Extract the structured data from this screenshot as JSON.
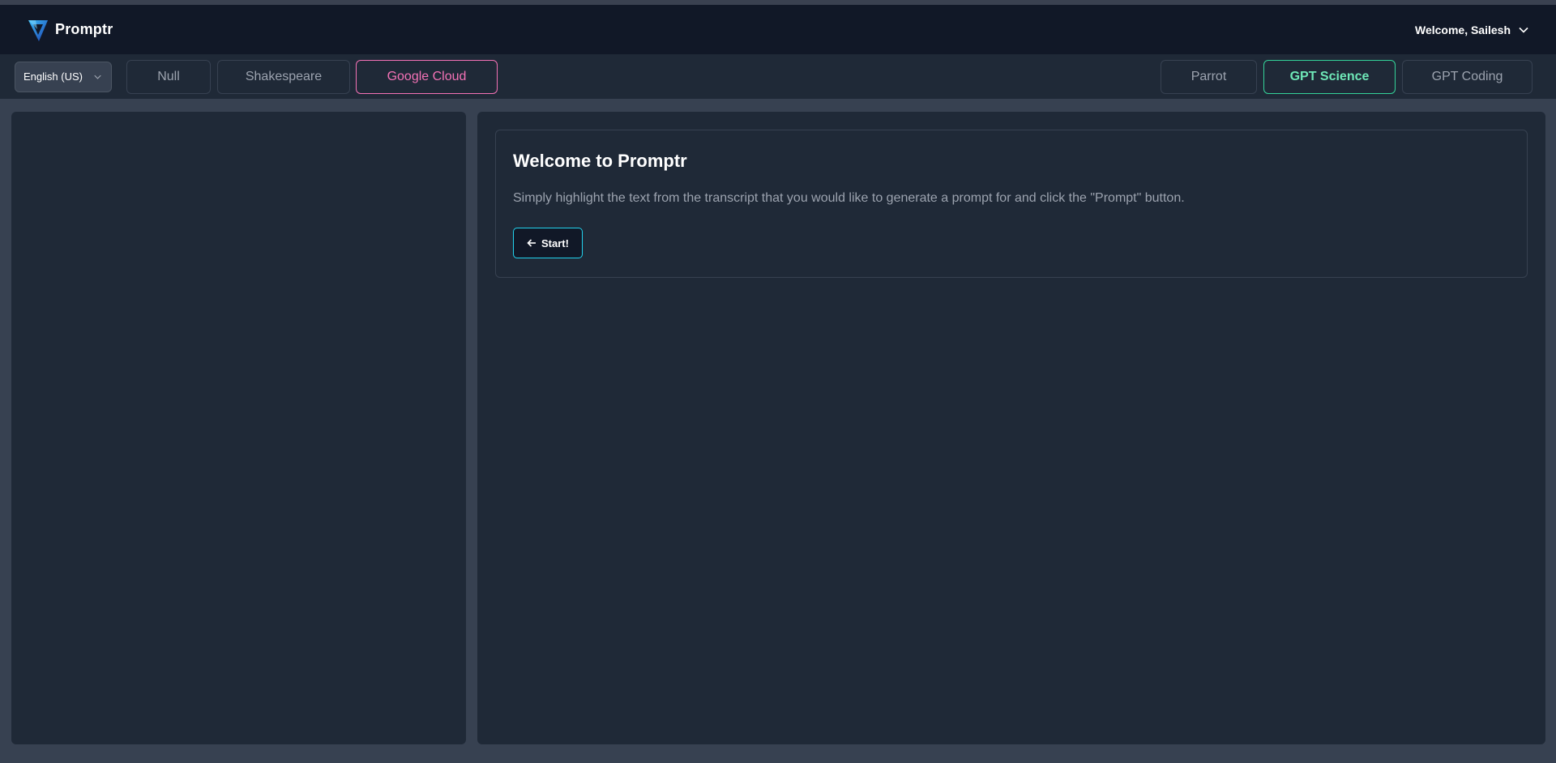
{
  "app": {
    "name": "Promptr",
    "logo_icon": "promptr-logo-icon"
  },
  "header": {
    "welcome_label": "Welcome, Sailesh",
    "menu_icon": "chevron-down-icon"
  },
  "toolbar": {
    "language": {
      "selected": "English (US)",
      "icon": "chevron-down-icon"
    },
    "left_modes": [
      {
        "label": "Null",
        "state": "default"
      },
      {
        "label": "Shakespeare",
        "state": "default"
      },
      {
        "label": "Google Cloud",
        "state": "active",
        "color": "#f472b6"
      }
    ],
    "right_modes": [
      {
        "label": "Parrot",
        "state": "default"
      },
      {
        "label": "GPT Science",
        "state": "active",
        "color": "#34d399"
      },
      {
        "label": "GPT Coding",
        "state": "default"
      }
    ]
  },
  "main": {
    "title": "Welcome to Promptr",
    "instructions": "Simply highlight the text from the transcript that you would like to generate a prompt for and click the \"Prompt\" button.",
    "start_button": {
      "label": "Start!",
      "icon": "arrow-left-icon",
      "border_color": "#22d3ee"
    }
  },
  "colors": {
    "page_bg": "#374151",
    "navbar_bg": "#111827",
    "panel_bg": "#1f2937",
    "muted_text": "#9ca3af"
  }
}
